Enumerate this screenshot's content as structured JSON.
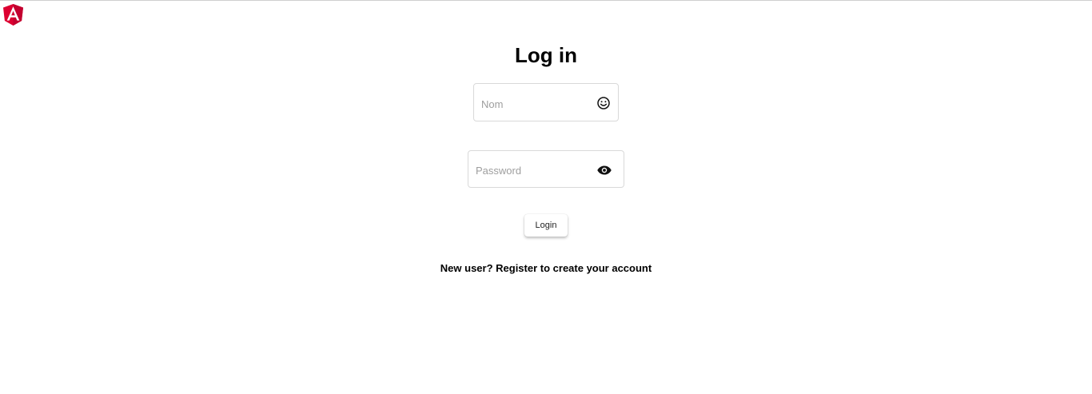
{
  "app": {
    "logo_icon": "angular-logo-icon",
    "brand_color": "#dd0031"
  },
  "page": {
    "title": "Log in"
  },
  "form": {
    "name_field": {
      "placeholder": "Nom",
      "value": "",
      "icon": "smiley-face-icon"
    },
    "password_field": {
      "placeholder": "Password",
      "value": "",
      "icon": "eye-icon"
    },
    "login_label": "Login",
    "register_text": "New user? Register to create your account"
  }
}
